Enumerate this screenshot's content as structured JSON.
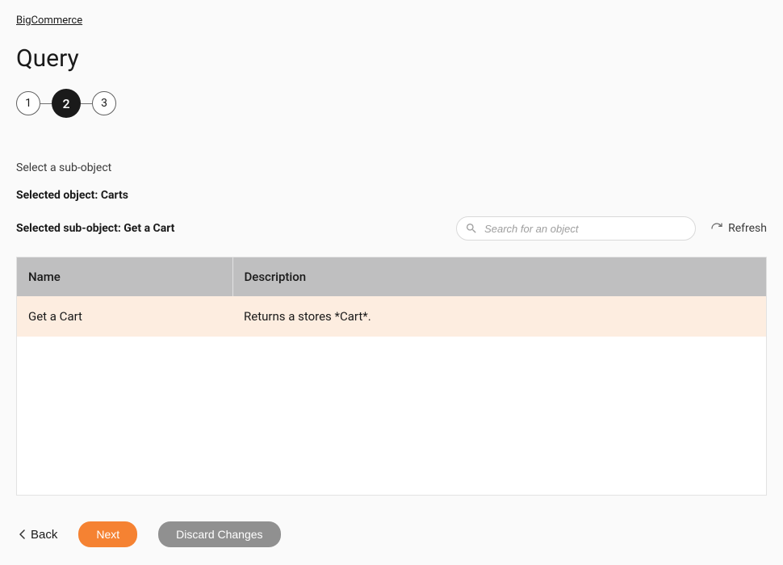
{
  "breadcrumb": {
    "root": "BigCommerce"
  },
  "page": {
    "title": "Query"
  },
  "stepper": {
    "steps": [
      "1",
      "2",
      "3"
    ],
    "active_index": 1
  },
  "instruction": "Select a sub-object",
  "selected_object_label": "Selected object: Carts",
  "selected_sub_label": "Selected sub-object: Get a Cart",
  "search": {
    "placeholder": "Search for an object"
  },
  "refresh_label": "Refresh",
  "table": {
    "columns": {
      "name": "Name",
      "description": "Description"
    },
    "rows": [
      {
        "name": "Get a Cart",
        "description": "Returns a stores *Cart*.",
        "selected": true
      }
    ]
  },
  "buttons": {
    "back": "Back",
    "next": "Next",
    "discard": "Discard Changes"
  }
}
